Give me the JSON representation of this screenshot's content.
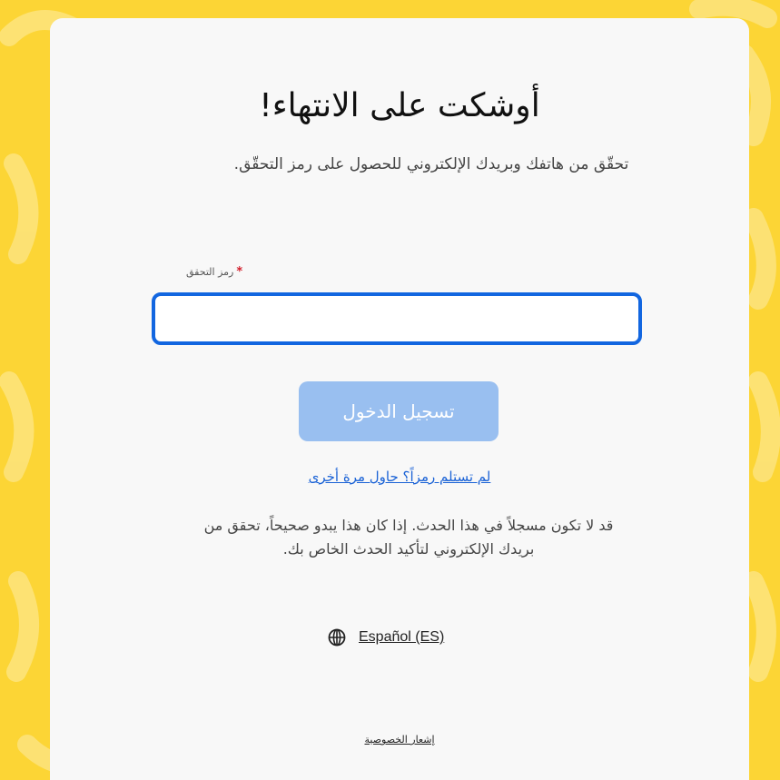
{
  "colors": {
    "background": "#fcd535",
    "card": "#f8f8f8",
    "input_border": "#1266e0",
    "button": "#99bff0",
    "link": "#1a62d6",
    "required": "#d21e2b"
  },
  "page": {
    "title": "أوشكت على الانتهاء!",
    "subtitle": "تحقّق من هاتفك وبريدك الإلكتروني للحصول على رمز التحقّق."
  },
  "form": {
    "code_label": "رمز التحقق",
    "required_marker": "*",
    "code_value": "",
    "submit_label": "تسجيل الدخول"
  },
  "links": {
    "retry": "لم تستلم رمزاً؟ حاول مرة أخرى",
    "privacy": "إشعار الخصوصية"
  },
  "notice": "قد لا تكون مسجلاً في هذا الحدث. إذا كان هذا يبدو صحيحاً، تحقق من بريدك الإلكتروني لتأكيد الحدث الخاص بك.",
  "language": {
    "icon": "globe-icon",
    "label": "Español (ES)"
  }
}
